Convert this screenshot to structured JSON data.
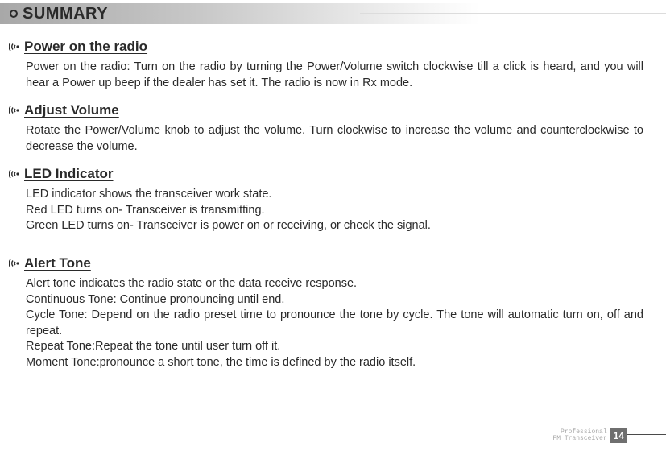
{
  "header": {
    "title": "SUMMARY"
  },
  "sections": [
    {
      "title": "Power on the radio",
      "body": "Power on the radio: Turn on the radio by turning the Power/Volume switch clockwise till a click is heard, and you will hear a Power up beep if the dealer has set it. The radio is now in Rx mode."
    },
    {
      "title": "Adjust Volume",
      "body": "Rotate the Power/Volume knob to adjust the volume. Turn clockwise to increase the volume and counterclockwise to decrease the volume."
    },
    {
      "title": "LED Indicator",
      "body_lines": [
        "LED indicator shows the transceiver work state.",
        "Red LED turns on- Transceiver is transmitting.",
        "Green LED turns on- Transceiver is power on or receiving, or check the signal."
      ]
    },
    {
      "title": "Alert Tone",
      "body_lines": [
        "Alert tone  indicates the radio state or the data  receive response.",
        "Continuous Tone: Continue pronouncing until end.",
        "Cycle Tone: Depend on the radio preset time to pronounce the tone by cycle. The tone will automatic turn on, off and repeat.",
        "Repeat Tone:Repeat the tone until user turn off it.",
        "Moment Tone:pronounce a short tone, the time is defined by the radio itself."
      ]
    }
  ],
  "footer": {
    "line1": "Professional",
    "line2": "FM Transceiver",
    "page": "14"
  }
}
